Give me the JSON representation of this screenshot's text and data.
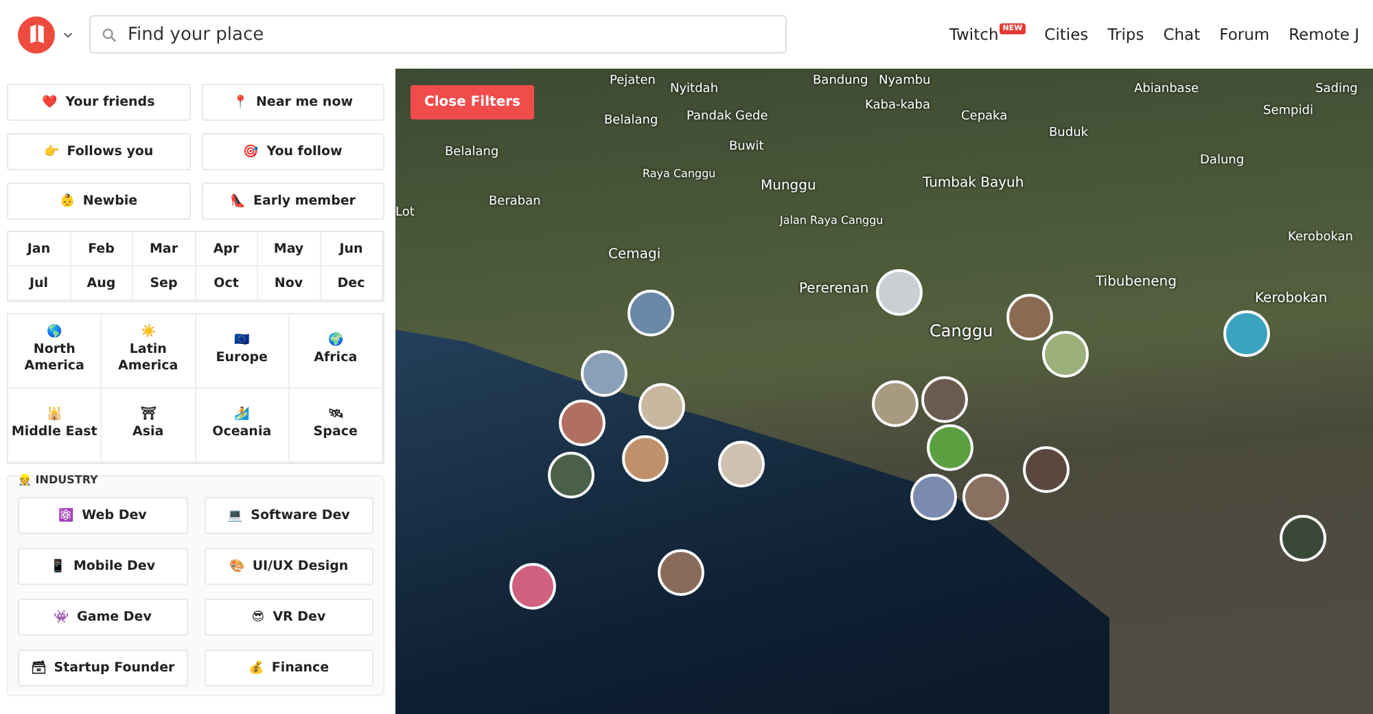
{
  "header": {
    "search": {
      "placeholder": "Find your place"
    },
    "nav": [
      {
        "label": "Twitch",
        "badge": "NEW"
      },
      {
        "label": "Cities"
      },
      {
        "label": "Trips"
      },
      {
        "label": "Chat"
      },
      {
        "label": "Forum"
      },
      {
        "label": "Remote J"
      }
    ]
  },
  "filters": {
    "social": [
      {
        "icon": "❤️",
        "label": "Your friends"
      },
      {
        "icon": "📍",
        "label": "Near me now"
      },
      {
        "icon": "👉",
        "label": "Follows you"
      },
      {
        "icon": "🎯",
        "label": "You follow"
      },
      {
        "icon": "👶",
        "label": "Newbie"
      },
      {
        "icon": "👠",
        "label": "Early member"
      }
    ],
    "months": [
      "Jan",
      "Feb",
      "Mar",
      "Apr",
      "May",
      "Jun",
      "Jul",
      "Aug",
      "Sep",
      "Oct",
      "Nov",
      "Dec"
    ],
    "regions": [
      {
        "icon": "🌎",
        "label": "North America"
      },
      {
        "icon": "☀️",
        "label": "Latin America"
      },
      {
        "icon": "🇪🇺",
        "label": "Europe"
      },
      {
        "icon": "🌍",
        "label": "Africa"
      },
      {
        "icon": "🕌",
        "label": "Middle East"
      },
      {
        "icon": "⛩",
        "label": "Asia"
      },
      {
        "icon": "🏄",
        "label": "Oceania"
      },
      {
        "icon": "🛰",
        "label": "Space"
      }
    ],
    "industry": {
      "icon": "👷",
      "title": "INDUSTRY",
      "items": [
        {
          "icon": "⚛️",
          "label": "Web Dev"
        },
        {
          "icon": "💻",
          "label": "Software Dev"
        },
        {
          "icon": "📱",
          "label": "Mobile Dev"
        },
        {
          "icon": "🎨",
          "label": "UI/UX Design"
        },
        {
          "icon": "👾",
          "label": "Game Dev"
        },
        {
          "icon": "😎",
          "label": "VR Dev"
        },
        {
          "icon": "🗃",
          "label": "Startup Founder"
        },
        {
          "icon": "💰",
          "label": "Finance"
        }
      ]
    }
  },
  "map": {
    "close_button": "Close Filters",
    "labels": [
      "Pejaten",
      "Nyitdah",
      "Bandung",
      "Nyambu",
      "Kaba-kaba",
      "Abianbase",
      "Sading",
      "Belalang",
      "Pandak Gede",
      "Cepaka",
      "Sempidi",
      "Belalang",
      "Buwit",
      "Buduk",
      "Raya Canggu",
      "Dalung",
      "Munggu",
      "Tumbak Bayuh",
      "Beraban",
      "Lot",
      "Jalan Raya Canggu",
      "Kerobokan",
      "Cemagi",
      "Pererenan",
      "Tibubeneng",
      "Canggu",
      "Kerobokan"
    ]
  }
}
